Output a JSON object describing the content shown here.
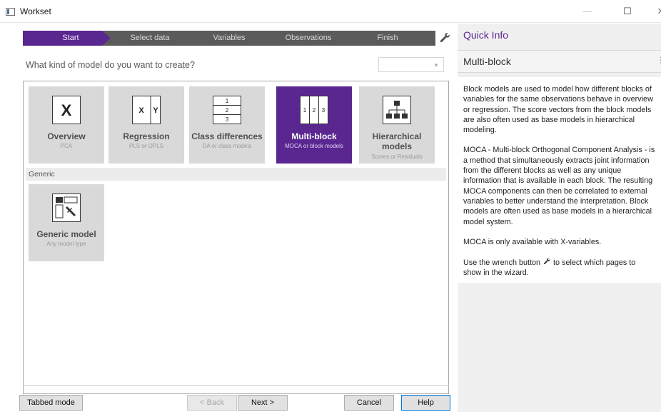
{
  "window": {
    "title": "Workset"
  },
  "wizard": {
    "steps": [
      {
        "label": "Start",
        "active": true
      },
      {
        "label": "Select data",
        "active": false
      },
      {
        "label": "Variables",
        "active": false
      },
      {
        "label": "Observations",
        "active": false
      },
      {
        "label": "Finish",
        "active": false
      }
    ]
  },
  "question": "What kind of model do you want to create?",
  "filter": {
    "value": ""
  },
  "model_types": [
    {
      "title": "Overview",
      "subtitle": "PCA",
      "icon": "x-letter-icon",
      "selected": false
    },
    {
      "title": "Regression",
      "subtitle": "PLS or OPLS",
      "icon": "x-y-split-icon",
      "selected": false
    },
    {
      "title": "Class differences",
      "subtitle": "DA or class models",
      "icon": "stacked-classes-icon",
      "selected": false
    },
    {
      "title": "Multi-block",
      "subtitle": "MOCA or block models",
      "icon": "multi-block-icon",
      "selected": true
    },
    {
      "title": "Hierarchical models",
      "subtitle": "Scores or Residuals",
      "icon": "hierarchy-tree-icon",
      "selected": false
    }
  ],
  "generic_group": {
    "header": "Generic",
    "tile": {
      "title": "Generic model",
      "subtitle": "Any model type",
      "icon": "generic-model-icon"
    }
  },
  "icon_text": {
    "x": "X",
    "rx": "X",
    "ry": "Y",
    "c1": "1",
    "c2": "2",
    "c3": "3",
    "m1": "1",
    "m2": "2",
    "m3": "3"
  },
  "buttons": {
    "tabbed_mode": "Tabbed mode",
    "back": "< Back",
    "next": "Next >",
    "cancel": "Cancel",
    "help": "Help"
  },
  "quick_info": {
    "title": "Quick Info",
    "section": "Multi-block",
    "paragraphs": [
      "Block models are used to model how different blocks of variables for the same observations behave in overview or regression. The score vectors from the block models are also often used as base models in hierarchical modeling.",
      "MOCA - Multi-block Orthogonal Component Analysis - is a method that simultaneously extracts joint information from the different blocks as well as any unique information that is available in each block. The resulting MOCA components can then be correlated to external variables to better understand the interpretation. Block models are often used as base models in a hierarchical model system.",
      "MOCA is only available with X-variables."
    ],
    "wrench_text_before": "Use the wrench button",
    "wrench_text_after": "to select which pages to show in the wizard."
  },
  "colors": {
    "accent": "#5a2690",
    "step_inactive": "#5b5b5b",
    "tile_bg": "#d9d9d9"
  }
}
